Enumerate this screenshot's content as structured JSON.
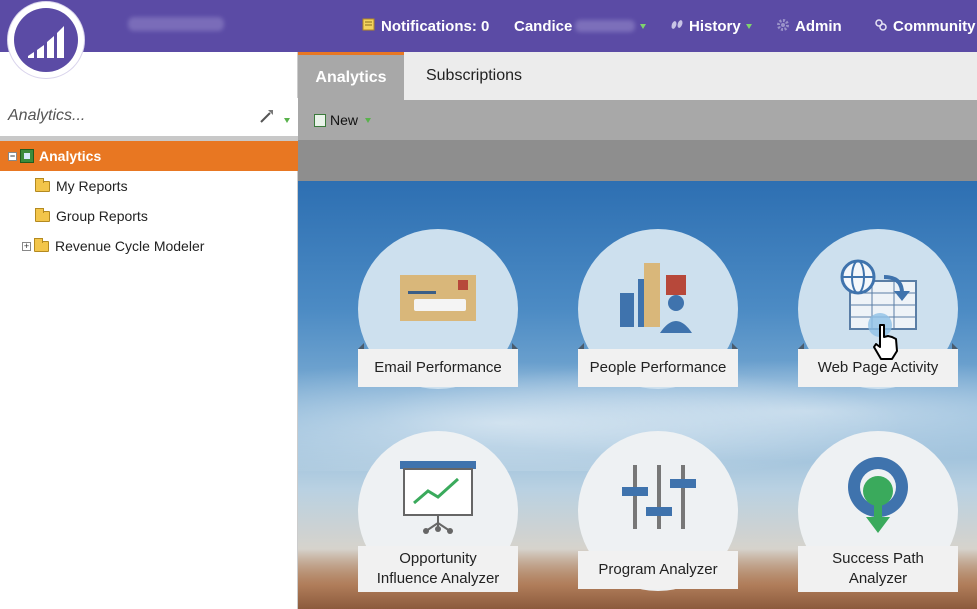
{
  "topbar": {
    "logo_icon": "marketo-logo-icon",
    "notifications_label": "Notifications: 0",
    "user_label": "Candice",
    "history_label": "History",
    "admin_label": "Admin",
    "community_label": "Community"
  },
  "sidebar": {
    "search_placeholder": "Analytics...",
    "tree": [
      {
        "label": "Analytics",
        "active": true
      },
      {
        "label": "My Reports"
      },
      {
        "label": "Group Reports"
      },
      {
        "label": "Revenue Cycle Modeler"
      }
    ]
  },
  "tabs": [
    {
      "label": "Analytics",
      "active": true
    },
    {
      "label": "Subscriptions"
    }
  ],
  "toolbar": {
    "new_label": "New"
  },
  "tiles": [
    {
      "label": "Email Performance",
      "icon": "envelope-icon"
    },
    {
      "label": "People Performance",
      "icon": "people-bar-chart-icon"
    },
    {
      "label": "Web Page Activity",
      "icon": "web-grid-icon"
    },
    {
      "label_line1": "Opportunity",
      "label_line2": "Influence Analyzer",
      "icon": "presentation-chart-icon"
    },
    {
      "label": "Program Analyzer",
      "icon": "sliders-icon"
    },
    {
      "label_line1": "Success Path",
      "label_line2": "Analyzer",
      "icon": "map-pin-icon"
    }
  ],
  "colors": {
    "header": "#5b4ba5",
    "accent_orange": "#e87722",
    "caret_green": "#7fd36e"
  }
}
